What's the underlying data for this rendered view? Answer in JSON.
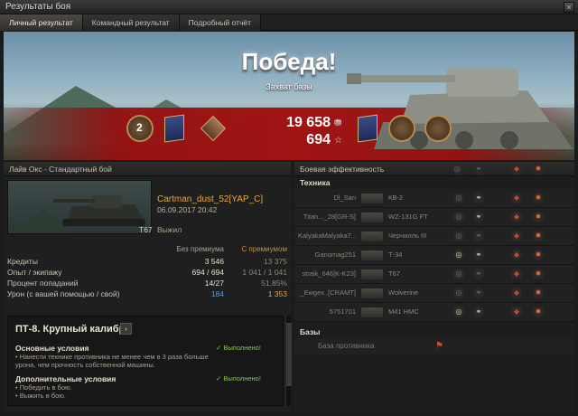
{
  "window": {
    "title": "Результаты боя",
    "close": "×"
  },
  "tabs": [
    {
      "label": "Личный результат",
      "active": true
    },
    {
      "label": "Командный результат",
      "active": false
    },
    {
      "label": "Подробный отчёт",
      "active": false
    }
  ],
  "banner": {
    "result": "Победа!",
    "reason": "Захват базы",
    "credits": "19 658",
    "credits_icon": "coin-icon",
    "xp": "694",
    "xp_icon": "star-icon",
    "mastery_level": "2"
  },
  "left": {
    "header": "Лайв Окс - Стандартный бой",
    "player": "Cartman_dust_52[YAP_C]",
    "date": "06.09.2017 20:42",
    "tank": "T67",
    "status": "Выжил",
    "col_no_premium": "Без премиума",
    "col_premium": "С премиумом",
    "rows": [
      {
        "label": "Кредиты",
        "a": "3 546",
        "b": "13 375"
      },
      {
        "label": "Опыт / экипажу",
        "a": "694 / 694",
        "b": "1 041 / 1 041"
      },
      {
        "label": "Процент попаданий",
        "a": "14/27",
        "b": "51,85%"
      },
      {
        "label": "Урон (с вашей помощью / свой)",
        "a": "184",
        "b": "1 353"
      }
    ],
    "mission": {
      "title": "ПТ-8. Крупный калибр",
      "arrow": "›",
      "main_title": "Основные условия",
      "main_text": "• Нанести технике противника не менее чем в 3 раза больше урона, чем прочность собственной машины.",
      "main_status": "✓ Выполнено!",
      "extra_title": "Дополнительные условия",
      "extra_text_1": "• Победить в бою.",
      "extra_text_2": "• Выжить в бою.",
      "extra_status": "✓ Выполнено!"
    }
  },
  "right": {
    "header": "Боевая эффективность",
    "section_vehicles": "Техника",
    "section_bases": "Базы",
    "bases_label": "База противника",
    "enemies": [
      {
        "player": "Dl_San",
        "tank": "КВ-2"
      },
      {
        "player": "Titan..._28[GR-S]",
        "tank": "WZ-131G FT"
      },
      {
        "player": "KalyakaMalyaka7...",
        "tank": "Черчилль III"
      },
      {
        "player": "Ganomag251",
        "tank": "Т-34"
      },
      {
        "player": "straik_646[K-K23]",
        "tank": "T67"
      },
      {
        "player": "_Ewgex..[CRAMT]",
        "tank": "Wolverine"
      },
      {
        "player": "5751701",
        "tank": "M41 HMC"
      }
    ]
  }
}
